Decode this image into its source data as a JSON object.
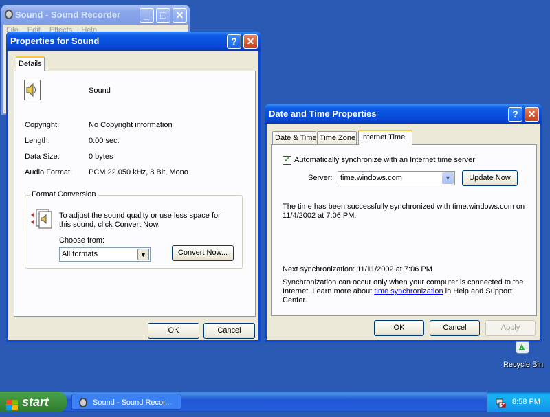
{
  "sound_recorder": {
    "title": "Sound - Sound Recorder",
    "menu": [
      "File",
      "Edit",
      "Effects",
      "Help"
    ]
  },
  "props_sound": {
    "title": "Properties for Sound",
    "help_glyph": "?",
    "close_glyph": "✕",
    "tab": "Details",
    "name": "Sound",
    "fields": [
      {
        "label": "Copyright:",
        "value": "No Copyright information"
      },
      {
        "label": "Length:",
        "value": "0.00 sec."
      },
      {
        "label": "Data Size:",
        "value": "0 bytes"
      },
      {
        "label": "Audio Format:",
        "value": "PCM 22.050 kHz, 8 Bit, Mono"
      }
    ],
    "format_group": "Format Conversion",
    "format_desc": "To adjust the sound quality or use less space for this sound, click Convert Now.",
    "choose_label": "Choose from:",
    "choose_value": "All formats",
    "convert_button": "Convert Now...",
    "ok": "OK",
    "cancel": "Cancel"
  },
  "datetime": {
    "title": "Date and Time Properties",
    "help_glyph": "?",
    "close_glyph": "✕",
    "tabs": [
      "Date & Time",
      "Time Zone",
      "Internet Time"
    ],
    "active_tab": "Internet Time",
    "auto_sync_label": "Automatically synchronize with an Internet time server",
    "auto_sync_checked": true,
    "server_label": "Server:",
    "server_value": "time.windows.com",
    "update_button": "Update Now",
    "status_msg": "The time has been successfully synchronized with time.windows.com on 11/4/2002 at 7:06 PM.",
    "next_sync": "Next synchronization: 11/11/2002 at 7:06 PM",
    "note_before": "Synchronization can occur only when your computer is connected to the Internet.  Learn more about ",
    "note_link": "time synchronization",
    "note_after": " in Help and Support Center.",
    "ok": "OK",
    "cancel": "Cancel",
    "apply": "Apply"
  },
  "desktop": {
    "recycle_bin": "Recycle Bin"
  },
  "taskbar": {
    "start": "start",
    "task": "Sound - Sound Recor...",
    "clock": "8:58 PM"
  }
}
